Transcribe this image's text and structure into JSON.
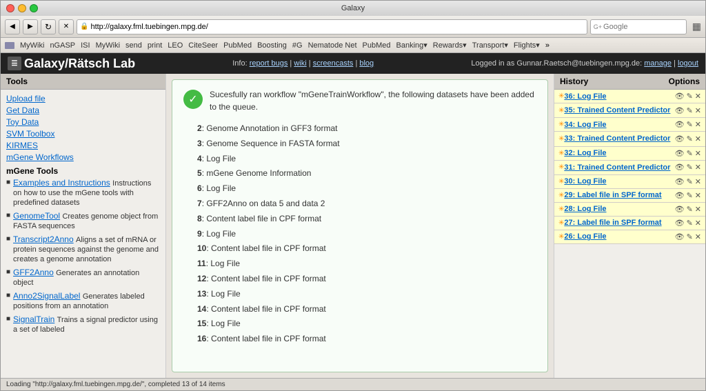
{
  "window": {
    "title": "Galaxy"
  },
  "toolbar": {
    "url": "http://galaxy.fml.tuebingen.mpg.de/",
    "search_placeholder": "Google"
  },
  "bookmarks": {
    "items": [
      "MyWiki",
      "nGASP",
      "ISI",
      "MyWiki",
      "send",
      "print",
      "LEO",
      "CiteSeer",
      "PubMed",
      "Boosting",
      "#G",
      "Nematode Net",
      "PubMed",
      "Banking▾",
      "Rewards▾",
      "Transport▾",
      "Flights▾",
      "»"
    ]
  },
  "galaxy_header": {
    "logo": "Galaxy/Rätsch Lab",
    "info_label": "Info:",
    "info_links": [
      "report bugs",
      "wiki",
      "screencasts",
      "blog"
    ],
    "user_label": "Logged in as Gunnar.Raetsch@tuebingen.mpg.de:",
    "user_links": [
      "manage",
      "logout"
    ]
  },
  "sidebar": {
    "header": "Tools",
    "links": [
      "Upload file",
      "Get Data",
      "Toy Data",
      "SVM Toolbox",
      "KIRMES",
      "mGene Workflows"
    ],
    "section_title": "mGene Tools",
    "items": [
      {
        "link": "Examples and Instructions",
        "desc": "Instructions on how to use the mGene tools with predefined datasets"
      },
      {
        "link": "GenomeTool",
        "desc": "Creates genome object from FASTA sequences"
      },
      {
        "link": "Transcript2Anno",
        "desc": "Aligns a set of mRNA or protein sequences against the genome and creates a genome annotation"
      },
      {
        "link": "GFF2Anno",
        "desc": "Generates an annotation object"
      },
      {
        "link": "Anno2SignalLabel",
        "desc": "Generates labeled positions from an annotation"
      },
      {
        "link": "SignalTrain",
        "desc": "Trains a signal predictor using a set of labeled"
      }
    ]
  },
  "main_content": {
    "success_message": "Sucesfully ran workflow \"mGeneTrainWorkflow\", the following datasets have been added to the queue.",
    "datasets": [
      {
        "num": "2",
        "label": "Genome Annotation in GFF3 format"
      },
      {
        "num": "3",
        "label": "Genome Sequence in FASTA format"
      },
      {
        "num": "4",
        "label": "Log File"
      },
      {
        "num": "5",
        "label": "mGene Genome Information"
      },
      {
        "num": "6",
        "label": "Log File"
      },
      {
        "num": "7",
        "label": "GFF2Anno on data 5 and data 2"
      },
      {
        "num": "8",
        "label": "Content label file in CPF format"
      },
      {
        "num": "9",
        "label": "Log File"
      },
      {
        "num": "10",
        "label": "Content label file in CPF format"
      },
      {
        "num": "11",
        "label": "Log File"
      },
      {
        "num": "12",
        "label": "Content label file in CPF format"
      },
      {
        "num": "13",
        "label": "Log File"
      },
      {
        "num": "14",
        "label": "Content label file in CPF format"
      },
      {
        "num": "15",
        "label": "Log File"
      },
      {
        "num": "16",
        "label": "Content label file in CPF format"
      }
    ]
  },
  "history": {
    "title": "History",
    "options_label": "Options",
    "items": [
      {
        "id": "36",
        "label": "36: Log File",
        "multiline": false,
        "style": "yellow"
      },
      {
        "id": "35",
        "label": "35: Trained Content Predictor",
        "multiline": true,
        "style": "yellow"
      },
      {
        "id": "34",
        "label": "34: Log File",
        "multiline": false,
        "style": "yellow"
      },
      {
        "id": "33",
        "label": "33: Trained Content Predictor",
        "multiline": true,
        "style": "yellow"
      },
      {
        "id": "32",
        "label": "32: Log File",
        "multiline": false,
        "style": "yellow"
      },
      {
        "id": "31",
        "label": "31: Trained Content Predictor",
        "multiline": true,
        "style": "yellow"
      },
      {
        "id": "30",
        "label": "30: Log File",
        "multiline": false,
        "style": "yellow"
      },
      {
        "id": "29",
        "label": "29: Label file in SPF format",
        "multiline": false,
        "style": "yellow"
      },
      {
        "id": "28",
        "label": "28: Log File",
        "multiline": false,
        "style": "yellow"
      },
      {
        "id": "27",
        "label": "27: Label file in SPF format",
        "multiline": false,
        "style": "yellow"
      },
      {
        "id": "26",
        "label": "26: Log File",
        "multiline": false,
        "style": "yellow"
      }
    ]
  },
  "status_bar": {
    "text": "Loading \"http://galaxy.fml.tuebingen.mpg.de/\", completed 13 of 14 items"
  }
}
